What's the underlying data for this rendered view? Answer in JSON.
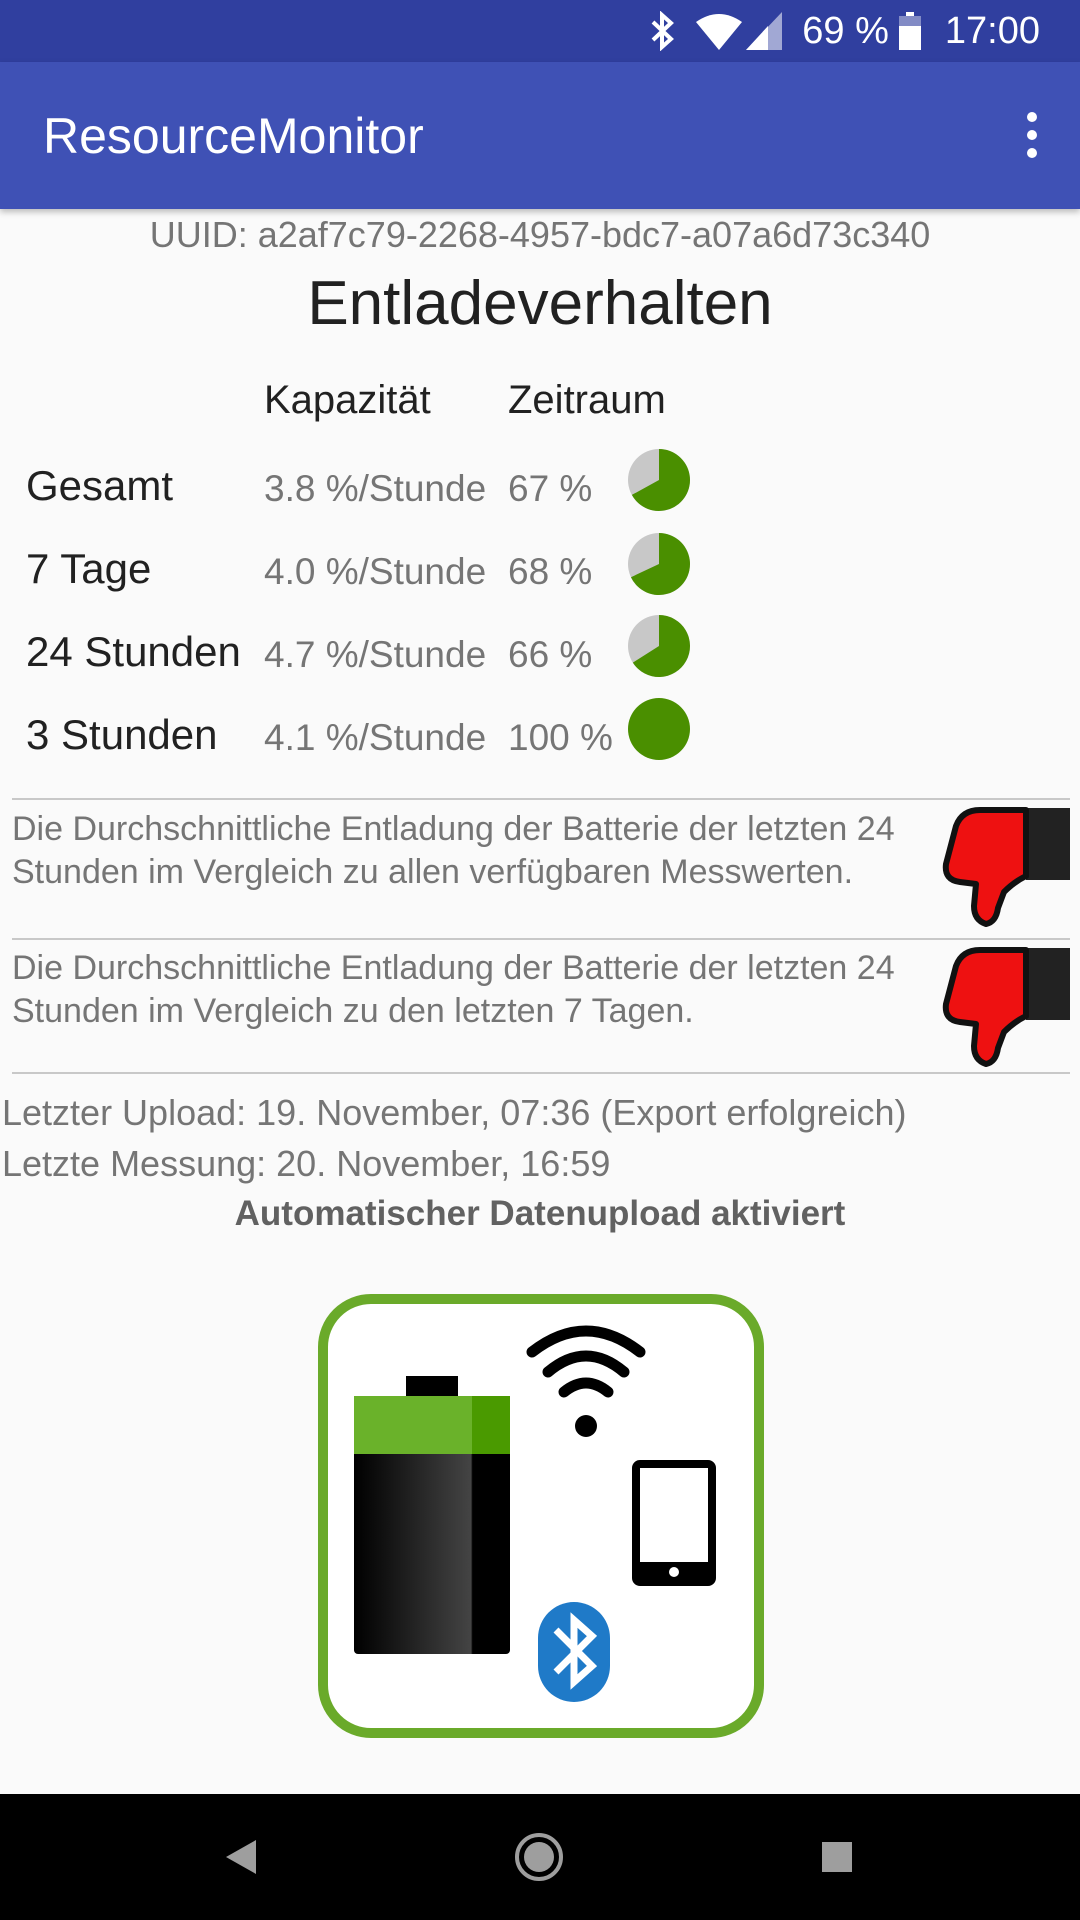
{
  "status_bar": {
    "battery_percent": "69 %",
    "time": "17:00"
  },
  "app_bar": {
    "title": "ResourceMonitor",
    "overflow_icon": "more-vert-icon"
  },
  "uuid_text": "UUID: a2af7c79-2268-4957-bdc7-a07a6d73c340",
  "heading": "Entladeverhalten",
  "table": {
    "headers": [
      "Kapazität",
      "Zeitraum"
    ],
    "rows": [
      {
        "label": "Gesamt",
        "capacity": "3.8 %/Stunde",
        "period": "67 %",
        "fraction": 0.67
      },
      {
        "label": "7 Tage",
        "capacity": "4.0 %/Stunde",
        "period": "68 %",
        "fraction": 0.68
      },
      {
        "label": "24 Stunden",
        "capacity": "4.7 %/Stunde",
        "period": "66 %",
        "fraction": 0.66
      },
      {
        "label": "3 Stunden",
        "capacity": "4.1 %/Stunde",
        "period": "100 %",
        "fraction": 1.0
      }
    ]
  },
  "comparisons": [
    {
      "text": "Die Durchschnittliche Entladung der Batterie der letzten 24 Stunden im Vergleich zu allen verfügbaren Messwerten.",
      "rating_icon": "thumbs-down-icon"
    },
    {
      "text": "Die Durchschnittliche Entladung der Batterie der letzten 24 Stunden im Vergleich zu den letzten 7 Tagen.",
      "rating_icon": "thumbs-down-icon"
    }
  ],
  "last_upload": "Letzter Upload: 19. November, 07:36 (Export erfolgreich)",
  "last_measurement": "Letzte Messung: 20. November, 16:59",
  "auto_upload": "Automatischer Datenupload aktiviert",
  "colors": {
    "status_bar": "#303f9f",
    "app_bar": "#3f51b5",
    "pie_fill": "#4a8f00",
    "pie_empty": "#c8c8c8",
    "thumb": "#ee1111",
    "logo_border": "#6aaa2a"
  }
}
